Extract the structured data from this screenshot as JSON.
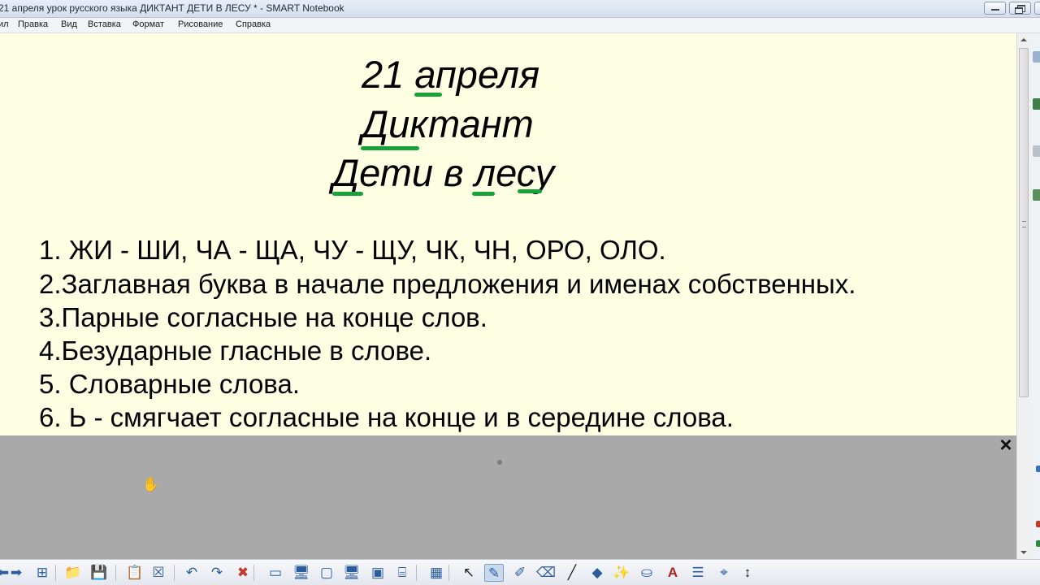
{
  "window": {
    "title": "21 апреля урок русского языка ДИКТАНТ ДЕТИ В ЛЕСУ * - SMART Notebook"
  },
  "menu": [
    {
      "label": "ил"
    },
    {
      "label": "Правка"
    },
    {
      "label": "Вид"
    },
    {
      "label": "Вставка"
    },
    {
      "label": "Формат"
    },
    {
      "label": "Рисование"
    },
    {
      "label": "Справка"
    }
  ],
  "page": {
    "date": "21 апреля",
    "type": "Диктант",
    "name": "Дети в лесу",
    "rules": [
      "1. ЖИ - ШИ, ЧА - ЩА, ЧУ - ЩУ, ЧК, ЧН, ОРО, ОЛО.",
      "2.Заглавная буква в начале предложения и именах собственных.",
      "3.Парные согласные на конце слов.",
      "4.Безударные гласные в слове.",
      "5. Словарные слова.",
      "6. Ь - смягчает согласные на конце и в середине слова."
    ],
    "background": "#fefee3",
    "underline_color": "#17a23a"
  },
  "shade": {
    "close_glyph": "×",
    "color": "#a9a9a9"
  },
  "toolbar": {
    "buttons": [
      {
        "name": "previous-page",
        "icon": "arrow-left-icon",
        "glyph": "➡"
      },
      {
        "name": "next-page",
        "icon": "arrow-right-icon",
        "glyph": "➡"
      },
      {
        "name": "add-page",
        "icon": "add-page-icon",
        "glyph": "⊞"
      },
      {
        "name": "open-file",
        "icon": "folder-icon",
        "glyph": "📁"
      },
      {
        "name": "save",
        "icon": "save-icon",
        "glyph": "💾"
      },
      {
        "name": "paste",
        "icon": "paste-icon",
        "glyph": "📋"
      },
      {
        "name": "delete-page",
        "icon": "close-box-icon",
        "glyph": "☒"
      },
      {
        "name": "undo",
        "icon": "undo-icon",
        "glyph": "↶"
      },
      {
        "name": "redo",
        "icon": "redo-icon",
        "glyph": "↷"
      },
      {
        "name": "delete",
        "icon": "delete-x-icon",
        "glyph": "✖"
      },
      {
        "name": "screen-shade",
        "icon": "screen-shade-icon",
        "glyph": "▭"
      },
      {
        "name": "full-screen",
        "icon": "monitor-icon",
        "glyph": "🖥"
      },
      {
        "name": "transparent-mode",
        "icon": "monitor-outline-icon",
        "glyph": "▢"
      },
      {
        "name": "dual-page",
        "icon": "monitor-dual-icon",
        "glyph": "🖥"
      },
      {
        "name": "screen-capture",
        "icon": "camera-icon",
        "glyph": "▣"
      },
      {
        "name": "document-camera",
        "icon": "document-camera-icon",
        "glyph": "⌸"
      },
      {
        "name": "insert-table",
        "icon": "table-icon",
        "glyph": "▦"
      },
      {
        "name": "select",
        "icon": "pointer-arrow-icon",
        "glyph": "↖"
      },
      {
        "name": "pen",
        "icon": "pen-icon",
        "glyph": "✎"
      },
      {
        "name": "creative-pen",
        "icon": "creative-pen-icon",
        "glyph": "✐"
      },
      {
        "name": "eraser",
        "icon": "eraser-icon",
        "glyph": "⌫"
      },
      {
        "name": "line",
        "icon": "line-icon",
        "glyph": "╱"
      },
      {
        "name": "shapes",
        "icon": "shapes-icon",
        "glyph": "◆"
      },
      {
        "name": "magic-pen",
        "icon": "magic-pen-icon",
        "glyph": "✨"
      },
      {
        "name": "fill",
        "icon": "fill-bucket-icon",
        "glyph": "⛀"
      },
      {
        "name": "text",
        "icon": "text-a-icon",
        "glyph": "A"
      },
      {
        "name": "properties",
        "icon": "properties-icon",
        "glyph": "☰"
      },
      {
        "name": "shape-recognition",
        "icon": "shape-recognition-icon",
        "glyph": "⌖"
      },
      {
        "name": "move-toolbar",
        "icon": "up-down-arrow-icon",
        "glyph": "↕"
      }
    ]
  }
}
